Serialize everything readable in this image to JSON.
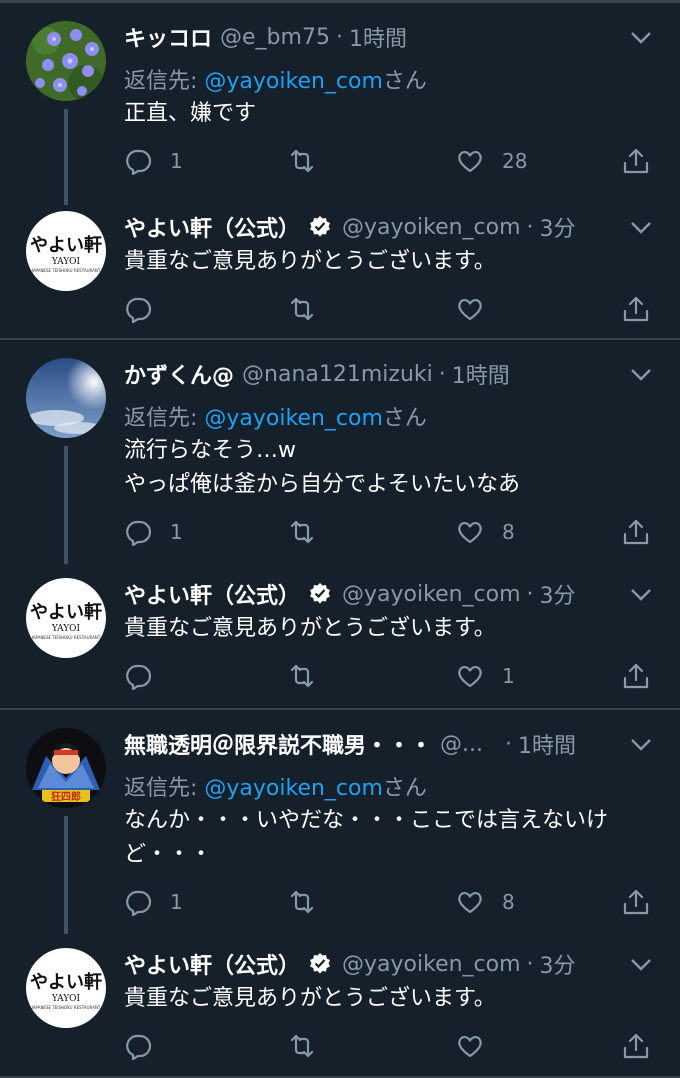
{
  "tweets": [
    {
      "name": "キッコロ",
      "handle": "@e_bm75",
      "sep": "·",
      "time": "1時間",
      "replying_to_label": "返信先: ",
      "replying_to_handle": "@yayoiken_com",
      "replying_to_suffix": "さん",
      "text": "正直、嫌です",
      "text2": "",
      "reply_count": "1",
      "retweet_count": "",
      "like_count": "28",
      "avatar": "flower-photo"
    },
    {
      "name": "やよい軒（公式）",
      "handle": "@yayoiken_com",
      "sep": "·",
      "time": "3分",
      "text": "貴重なご意見ありがとうございます。",
      "reply_count": "",
      "retweet_count": "",
      "like_count": "",
      "avatar": "yayoi-logo",
      "verified": true
    },
    {
      "name": "かずくん@",
      "handle": "@nana121mizuki",
      "sep": "·",
      "time": "1時間",
      "replying_to_label": "返信先: ",
      "replying_to_handle": "@yayoiken_com",
      "replying_to_suffix": "さん",
      "text": "流行らなそう…w",
      "text2": "やっぱ俺は釜から自分でよそいたいなあ",
      "reply_count": "1",
      "retweet_count": "",
      "like_count": "8",
      "avatar": "sky-photo"
    },
    {
      "name": "やよい軒（公式）",
      "handle": "@yayoiken_com",
      "sep": "·",
      "time": "3分",
      "text": "貴重なご意見ありがとうございます。",
      "reply_count": "",
      "retweet_count": "",
      "like_count": "1",
      "avatar": "yayoi-logo",
      "verified": true
    },
    {
      "name": "無職透明＠限界説不職男・・・",
      "handle": "@...",
      "sep": "·",
      "time": "1時間",
      "replying_to_label": "返信先: ",
      "replying_to_handle": "@yayoiken_com",
      "replying_to_suffix": "さん",
      "text": "なんか・・・いやだな・・・ここでは言えないけ",
      "text2": "ど・・・",
      "reply_count": "1",
      "retweet_count": "",
      "like_count": "8",
      "avatar": "anime-character"
    },
    {
      "name": "やよい軒（公式）",
      "handle": "@yayoiken_com",
      "sep": "·",
      "time": "3分",
      "text": "貴重なご意見ありがとうございます。",
      "reply_count": "",
      "retweet_count": "",
      "like_count": "",
      "avatar": "yayoi-logo",
      "verified": true
    }
  ],
  "logo": {
    "jp": "やよい軒",
    "en": "YAYOI",
    "sub": "JAPANESE TEISHOKU RESTAURANT"
  },
  "avatar_badge": "狂四郎",
  "icons": {
    "reply": "reply-icon",
    "retweet": "retweet-icon",
    "like": "heart-icon",
    "share": "share-icon",
    "menu": "chevron-down-icon",
    "verified": "verified-badge-icon"
  },
  "colors": {
    "background": "#15202b",
    "divider": "#38444d",
    "muted_text": "#8899a6",
    "link": "#1da1f2",
    "thread_line": "#3d5466"
  }
}
